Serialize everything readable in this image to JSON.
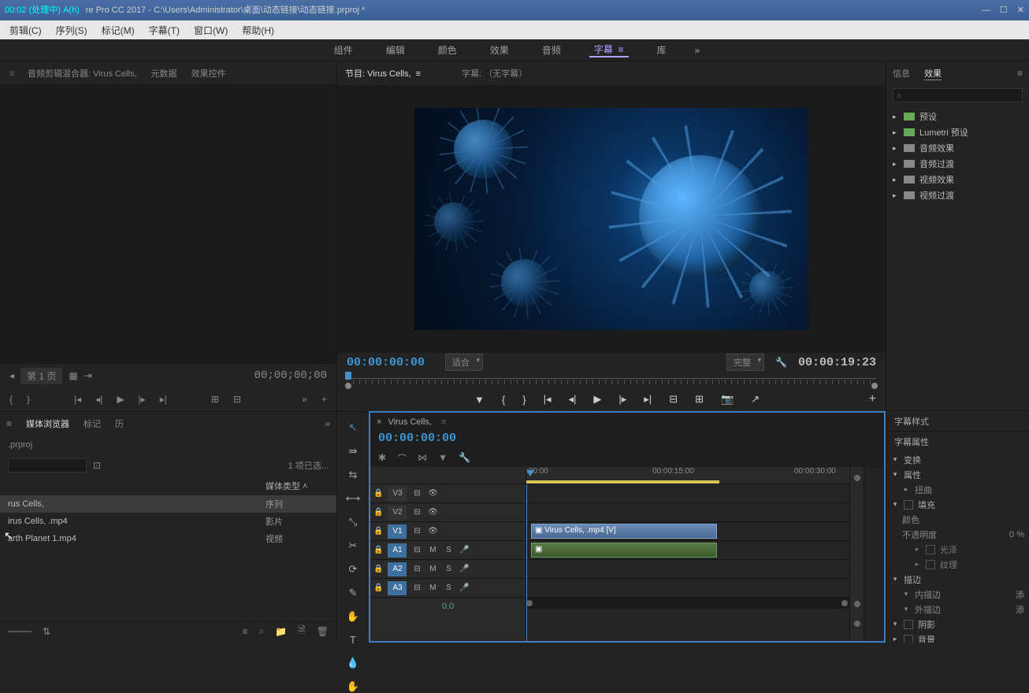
{
  "titlebar": {
    "prefix": "00:02 (处理中) A(h)",
    "text": "re Pro CC 2017 - C:\\Users\\Administrator\\桌面\\动态链接\\动态链接.prproj *"
  },
  "menubar": [
    "剪辑(C)",
    "序列(S)",
    "标记(M)",
    "字幕(T)",
    "窗口(W)",
    "帮助(H)"
  ],
  "workspace": {
    "tabs": [
      "组件",
      "编辑",
      "颜色",
      "效果",
      "音频",
      "字幕",
      "库"
    ],
    "active": 5
  },
  "source": {
    "tabs": [
      "音频剪辑混合器: Virus Cells,",
      "元数据",
      "效果控件"
    ],
    "timecode": "00;00;00;00",
    "pager": "第 1 页"
  },
  "program": {
    "tab_label": "节目: Virus Cells,",
    "caption_tab": "字幕: （无字幕）",
    "tc_left": "00:00:00:00",
    "fit": "适合",
    "quality": "完整",
    "tc_right": "00:00:19:23"
  },
  "effects_panel": {
    "tabs": [
      "信息",
      "效果"
    ],
    "active": 1,
    "search_icon": "⌕",
    "items": [
      "预设",
      "Lumetri 预设",
      "音频效果",
      "音频过渡",
      "视频效果",
      "视频过渡"
    ]
  },
  "project": {
    "tabs": [
      "媒体浏览器",
      "标记"
    ],
    "subtitle": ".prproj",
    "selection": "1 项已选...",
    "header_col2": "媒体类型",
    "rows": [
      {
        "name": "rus Cells,",
        "type": "序列",
        "sel": true
      },
      {
        "name": "irus Cells, .mp4",
        "type": "影片",
        "sel": false
      },
      {
        "name": "arth Planet 1.mp4",
        "type": "视频",
        "sel": false
      }
    ]
  },
  "timeline": {
    "seq_name": "Virus Cells,",
    "tc": "00:00:00:00",
    "ruler": [
      {
        "pos": 0,
        "label": ":00:00"
      },
      {
        "pos": 180,
        "label": "00:00:15:00"
      },
      {
        "pos": 360,
        "label": "00:00:30:00"
      }
    ],
    "tracks": {
      "v3": "V3",
      "v2": "V2",
      "v1": "V1",
      "a1": "A1",
      "a2": "A2",
      "a3": "A3"
    },
    "clip_v1": "Virus Cells, .mp4 [V]",
    "zoom_value": "0.0"
  },
  "title_panel": {
    "styles_header": "字幕样式",
    "props_header": "字幕属性",
    "props": {
      "transform": "变换",
      "attributes": "属性",
      "distort": "扭曲",
      "fill": "填充",
      "color": "颜色",
      "opacity": "不透明度",
      "shine": "光泽",
      "texture": "纹理",
      "stroke": "描边",
      "innerStroke": "内描边",
      "outerStroke": "外描边",
      "shadow": "阴影",
      "bg": "背景",
      "add": "添",
      "val_opacity": "0 %"
    }
  }
}
